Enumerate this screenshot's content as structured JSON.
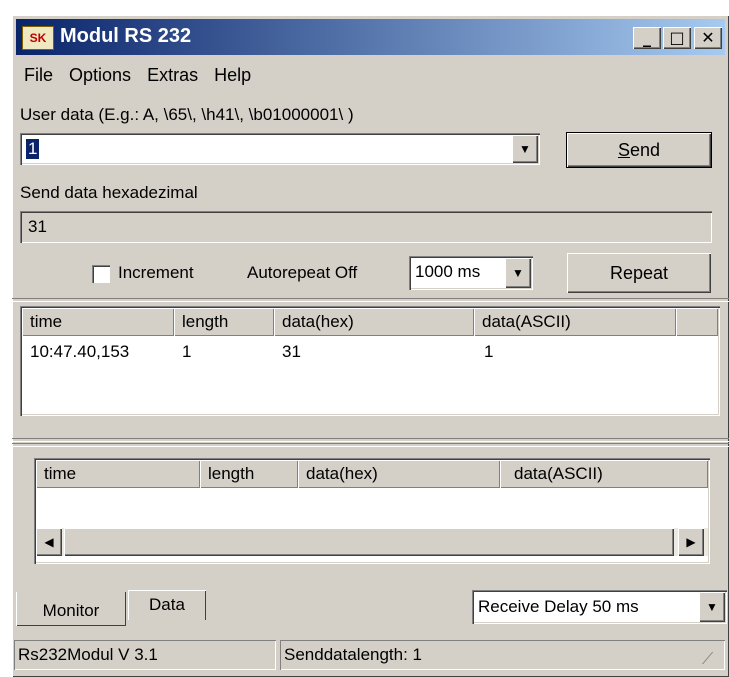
{
  "window": {
    "title": "Modul RS 232",
    "icon_text": "SK"
  },
  "title_buttons": {
    "minimize": "_",
    "maximize": "□",
    "close": "✕"
  },
  "menu": [
    "File",
    "Options",
    "Extras",
    "Help"
  ],
  "user_data": {
    "label": "User data  (E.g.:  A, \\65\\, \\h41\\, \\b01000001\\ )",
    "value": "1"
  },
  "send_button": "Send",
  "send_hex": {
    "label": "Send data hexadezimal",
    "value": "31"
  },
  "increment": {
    "label": "Increment",
    "checked": false
  },
  "autorepeat": {
    "label": "Autorepeat Off",
    "value": "1000 ms"
  },
  "repeat_button": "Repeat",
  "send_table": {
    "columns": [
      "time",
      "length",
      "data(hex)",
      "data(ASCII)"
    ],
    "rows": [
      [
        "10:47.40,153",
        "1",
        "31",
        "1"
      ]
    ]
  },
  "receive_table": {
    "columns": [
      "time",
      "length",
      "data(hex)",
      "data(ASCII)"
    ],
    "rows": []
  },
  "tabs": [
    "Monitor",
    "Data"
  ],
  "receive_delay": "Receive Delay 50 ms",
  "statusbar": {
    "left": "Rs232Modul   V 3.1",
    "right": "Senddatalength: 1"
  },
  "icons": {
    "dropdown": "triangle-down-icon",
    "scroll_left": "triangle-left-icon",
    "scroll_right": "triangle-right-icon",
    "resize": "size-grip-icon"
  }
}
